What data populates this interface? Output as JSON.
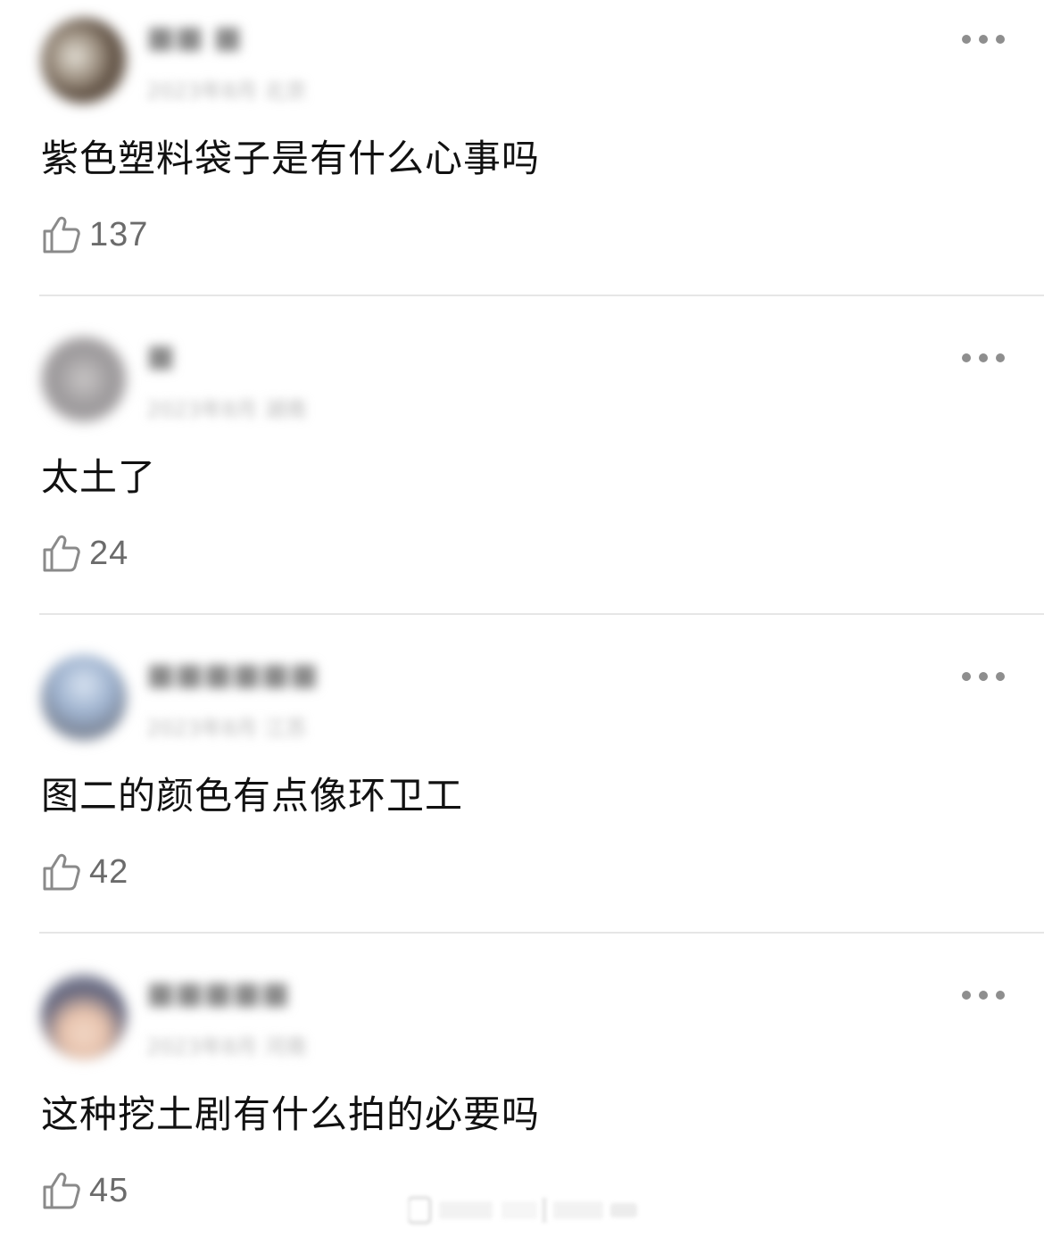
{
  "comments": [
    {
      "author": "■■ ■",
      "meta": "2023年8月 北京",
      "text": "紫色塑料袋子是有什么心事吗",
      "likes": "137"
    },
    {
      "author": "■",
      "meta": "2023年8月 湖南",
      "text": "太土了",
      "likes": "24"
    },
    {
      "author": "■■■■■■",
      "meta": "2023年8月 江苏",
      "text": "图二的颜色有点像环卫工",
      "likes": "42"
    },
    {
      "author": "■■■■■",
      "meta": "2023年8月 河南",
      "text": "这种挖土剧有什么拍的必要吗",
      "likes": "45"
    }
  ],
  "icons": {
    "more": "more-dots-icon",
    "like": "thumbs-up-icon"
  },
  "colors": {
    "text": "#111111",
    "secondary": "#6b6b6b",
    "divider": "#e6e6e6"
  }
}
